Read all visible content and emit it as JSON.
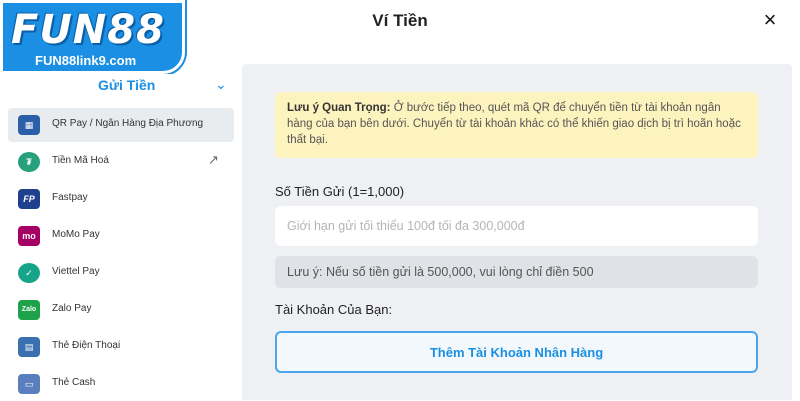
{
  "header": {
    "title": "Ví Tiền",
    "close_label": "×"
  },
  "logo": {
    "main": "FUN88",
    "sub": "FUN88link9.com"
  },
  "sidebar": {
    "section_label": "Gửi Tiền",
    "chevron": "⌄",
    "items": [
      {
        "label": "QR Pay / Ngân Hàng Địa Phương",
        "icon": "qr-code-icon",
        "icon_text": "▦",
        "color": "#2b5fa8"
      },
      {
        "label": "Tiền Mã Hoá",
        "icon": "tether-icon",
        "icon_text": "₮",
        "color": "#26a17b"
      },
      {
        "label": "Fastpay",
        "icon": "fastpay-icon",
        "icon_text": "FP",
        "color": "#1f3f8f"
      },
      {
        "label": "MoMo Pay",
        "icon": "momo-icon",
        "icon_text": "mo",
        "color": "#a50064"
      },
      {
        "label": "Viettel Pay",
        "icon": "viettel-pay-icon",
        "icon_text": "✓",
        "color": "#17a589"
      },
      {
        "label": "Zalo Pay",
        "icon": "zalo-pay-icon",
        "icon_text": "Zalo",
        "color": "#1fa34a"
      },
      {
        "label": "Thẻ Điện Thoại",
        "icon": "phone-card-icon",
        "icon_text": "▤",
        "color": "#3a6fb0"
      },
      {
        "label": "Thẻ Cash",
        "icon": "cash-card-icon",
        "icon_text": "▭",
        "color": "#5a7fbf"
      }
    ],
    "external_link_icon": "↗"
  },
  "notice": {
    "title": "Lưu ý Quan Trọng:",
    "body": " Ở bước tiếp theo, quét mã QR để chuyển tiền từ tài khoản ngân hàng của bạn bên dưới. Chuyển từ tài khoản khác có thể khiến giao dịch bị trì hoãn hoặc thất bại."
  },
  "amount": {
    "label": "Số Tiền Gửi (1=1,000)",
    "value": "",
    "placeholder": "Giới hạn gửi tối thiểu 100đ tối đa 300,000đ",
    "hint": "Lưu ý: Nếu số tiền gửi là 500,000, vui lòng chỉ điền 500"
  },
  "account": {
    "label": "Tài Khoản Của Bạn:",
    "add_button": "Thêm Tài Khoản Nhân Hàng"
  },
  "colors": {
    "brand": "#1a8fe3",
    "notice_bg": "#fdf3bf",
    "panel_bg": "#eef0f3",
    "active_bg": "#e9ecef"
  }
}
